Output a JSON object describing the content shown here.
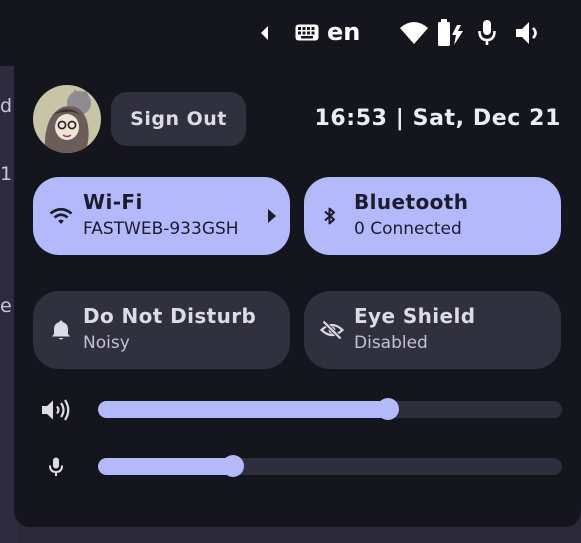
{
  "background": {
    "letters": [
      "d",
      "1",
      "e"
    ]
  },
  "topbar": {
    "language": "en",
    "icons": [
      "arrow-left-icon",
      "keyboard-icon",
      "wifi-icon",
      "battery-charging-icon",
      "microphone-icon",
      "volume-icon"
    ]
  },
  "header": {
    "sign_out_label": "Sign Out",
    "clock": "16:53 | Sat, Dec 21"
  },
  "tiles": {
    "wifi": {
      "title": "Wi-Fi",
      "subtitle": "FASTWEB-933GSH",
      "active": true
    },
    "bluetooth": {
      "title": "Bluetooth",
      "subtitle": "0 Connected",
      "active": true
    },
    "dnd": {
      "title": "Do Not Disturb",
      "subtitle": "Noisy",
      "active": false
    },
    "eye_shield": {
      "title": "Eye Shield",
      "subtitle": "Disabled",
      "active": false
    }
  },
  "sliders": {
    "volume": {
      "icon": "volume-icon",
      "level": 0.625
    },
    "microphone": {
      "icon": "microphone-icon",
      "level": 0.29
    }
  },
  "colors": {
    "accent": "#b4b9fb",
    "panel": "#15151d",
    "tile_inactive": "#31303f",
    "track": "#2f2e3c"
  }
}
